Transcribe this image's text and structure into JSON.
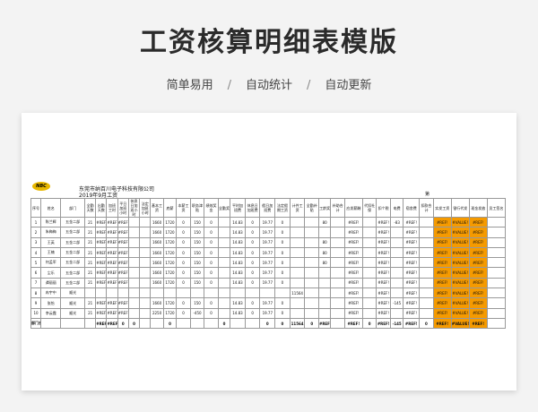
{
  "page": {
    "title": "工资核算明细表模版",
    "subtitle_items": [
      "简单易用",
      "自动统计",
      "自动更新"
    ],
    "separator": "/"
  },
  "sheet": {
    "logo_text": "NBC",
    "company": "东莞市纳百川电子科技有限公司",
    "period": "2019年9月工资",
    "page_mark": "第",
    "headers": [
      "序号",
      "姓名",
      "部门",
      "全勤天数",
      "出勤天数",
      "加班工时",
      "平日加班小时",
      "休息日加班小时",
      "法定加班小时",
      "基本工资",
      "底薪",
      "本薪工资",
      "职务津贴",
      "绩效奖金",
      "全勤奖",
      "平时加班费",
      "休息日加班费",
      "假日加班费",
      "法定假期工资",
      "计件工资",
      "全勤补贴",
      "工龄奖",
      "补助合计",
      "应发薪酬",
      "代扣社保",
      "扣个税",
      "电费",
      "宿舍费",
      "扣款合计",
      "实发工资",
      "银行代发",
      "现金发放",
      "员工签名"
    ],
    "rows": [
      [
        "1",
        "陈兰辉",
        "五金二部",
        "21",
        "#REF!",
        "#REF!",
        "#REF!",
        "",
        "",
        "1660",
        "1720",
        "0",
        "150",
        "0",
        "",
        "14.83",
        "0",
        "19.77",
        "0",
        "",
        "",
        "80",
        "",
        "#REF!",
        "",
        "#REF!",
        "-83",
        "#REF!",
        "",
        "#REF!",
        "#VALUE!",
        "#REF!",
        ""
      ],
      [
        "2",
        "朱梅梅",
        "五金二部",
        "21",
        "#REF!",
        "#REF!",
        "#REF!",
        "",
        "",
        "1660",
        "1720",
        "0",
        "150",
        "0",
        "",
        "14.83",
        "0",
        "19.77",
        "0",
        "",
        "",
        "",
        "",
        "#REF!",
        "",
        "#REF!",
        "",
        "#REF!",
        "",
        "#REF!",
        "#VALUE!",
        "#REF!",
        ""
      ],
      [
        "3",
        "王英",
        "五金二部",
        "21",
        "#REF!",
        "#REF!",
        "#REF!",
        "",
        "",
        "1660",
        "1720",
        "0",
        "150",
        "0",
        "",
        "14.83",
        "0",
        "19.77",
        "0",
        "",
        "",
        "80",
        "",
        "#REF!",
        "",
        "#REF!",
        "",
        "#REF!",
        "",
        "#REF!",
        "#VALUE!",
        "#REF!",
        ""
      ],
      [
        "4",
        "王楠",
        "五金二部",
        "21",
        "#REF!",
        "#REF!",
        "#REF!",
        "",
        "",
        "1660",
        "1720",
        "0",
        "150",
        "0",
        "",
        "14.83",
        "0",
        "19.77",
        "0",
        "",
        "",
        "80",
        "",
        "#REF!",
        "",
        "#REF!",
        "",
        "#REF!",
        "",
        "#REF!",
        "#VALUE!",
        "#REF!",
        ""
      ],
      [
        "5",
        "何孟军",
        "五金二部",
        "21",
        "#REF!",
        "#REF!",
        "#REF!",
        "",
        "",
        "1660",
        "1720",
        "0",
        "150",
        "0",
        "",
        "14.83",
        "0",
        "19.77",
        "0",
        "",
        "",
        "80",
        "",
        "#REF!",
        "",
        "#REF!",
        "",
        "#REF!",
        "",
        "#REF!",
        "#VALUE!",
        "#REF!",
        ""
      ],
      [
        "6",
        "尘乐",
        "五金二部",
        "21",
        "#REF!",
        "#REF!",
        "#REF!",
        "",
        "",
        "1660",
        "1720",
        "0",
        "150",
        "0",
        "",
        "14.83",
        "0",
        "19.77",
        "0",
        "",
        "",
        "",
        "",
        "#REF!",
        "",
        "#REF!",
        "",
        "#REF!",
        "",
        "#REF!",
        "#VALUE!",
        "#REF!",
        ""
      ],
      [
        "7",
        "谭丽丽",
        "五金二部",
        "21",
        "#REF!",
        "#REF!",
        "#REF!",
        "",
        "",
        "1660",
        "1720",
        "0",
        "150",
        "0",
        "",
        "14.83",
        "0",
        "19.77",
        "0",
        "",
        "",
        "",
        "",
        "#REF!",
        "",
        "#REF!",
        "",
        "#REF!",
        "",
        "#REF!",
        "#VALUE!",
        "#REF!",
        ""
      ],
      [
        "8",
        "冉宇中",
        "顺光",
        "",
        "",
        "",
        "",
        "",
        "",
        "",
        "",
        "",
        "",
        "",
        "",
        "",
        "",
        "",
        "",
        "11564",
        "",
        "",
        "",
        "#REF!",
        "",
        "#REF!",
        "",
        "#REF!",
        "",
        "#REF!",
        "#VALUE!",
        "#REF!",
        ""
      ],
      [
        "9",
        "张怡",
        "顺光",
        "21",
        "#REF!",
        "#REF!",
        "#REF!",
        "",
        "",
        "1660",
        "1720",
        "0",
        "150",
        "0",
        "",
        "14.83",
        "0",
        "19.77",
        "0",
        "",
        "",
        "",
        "",
        "#REF!",
        "",
        "#REF!",
        "-145",
        "#REF!",
        "",
        "#REF!",
        "#VALUE!",
        "#REF!",
        ""
      ],
      [
        "10",
        "李云霞",
        "顺光",
        "21",
        "#REF!",
        "#REF!",
        "#REF!",
        "",
        "",
        "2250",
        "1720",
        "0",
        "-450",
        "0",
        "",
        "14.83",
        "0",
        "19.77",
        "0",
        "",
        "",
        "",
        "",
        "#REF!",
        "",
        "#REF!",
        "",
        "#REF!",
        "",
        "#REF!",
        "#VALUE!",
        "#REF!",
        ""
      ]
    ],
    "total": [
      "部门合计",
      "",
      "",
      "",
      "#REF!",
      "#REF!",
      "0",
      "0",
      "",
      "",
      "0",
      "",
      "",
      "",
      "0",
      "",
      "",
      "0",
      "0",
      "11564",
      "0",
      "#REF!",
      "",
      "#REF!",
      "0",
      "#REF!",
      "-145",
      "#REF!",
      "0",
      "#REF!",
      "#VALUE!",
      "#REF!",
      ""
    ]
  },
  "colors": {
    "highlight": "#f59a00"
  }
}
